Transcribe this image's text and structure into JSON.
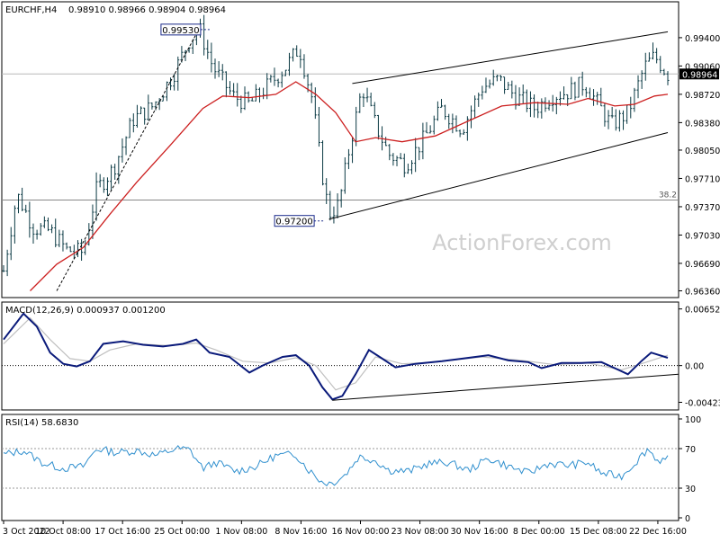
{
  "header": {
    "symbol": "EURCHF,H4",
    "ohlc": "0.98910 0.98966 0.98904 0.98964"
  },
  "watermark": "ActionForex.com",
  "colors": {
    "bars": "#0b3a44",
    "ma": "#cc1f1f",
    "macd_line": "#0a1a7a",
    "signal": "#bfbfbf",
    "rsi": "#2f8fce",
    "channel": "#000000",
    "price_tag_bg": "#000000",
    "price_tag_fg": "#ffffff",
    "grid_level": "#888888",
    "watermark": "#cfcfcf"
  },
  "chart_data": [
    {
      "type": "candlestick",
      "title": "EURCHF,H4",
      "xlabel": "",
      "ylabel": "",
      "x_ticks": [
        "3 Oct 2022",
        "10 Oct 08:00",
        "17 Oct 16:00",
        "25 Oct 00:00",
        "1 Nov 08:00",
        "8 Nov 16:00",
        "16 Nov 00:00",
        "23 Nov 08:00",
        "30 Nov 16:00",
        "8 Dec 00:00",
        "15 Dec 08:00",
        "22 Dec 16:00"
      ],
      "y_ticks": [
        0.994,
        0.9906,
        0.9872,
        0.9838,
        0.9805,
        0.9771,
        0.9737,
        0.9703,
        0.9669,
        0.9636
      ],
      "y_tick_labels": [
        "0.99400",
        "0.99060",
        "0.98720",
        "0.98380",
        "0.98050",
        "0.97710",
        "0.97370",
        "0.97030",
        "0.96690",
        "0.96360"
      ],
      "ylim": [
        0.9629,
        0.9982
      ],
      "last_price": 0.98964,
      "last_price_label": "0.98964",
      "fib_level": 0.9745,
      "fib_label": "38.2",
      "annotations": [
        {
          "label": "0.99530",
          "value": 0.9953,
          "at": "25 Oct"
        },
        {
          "label": "0.97200",
          "value": 0.972,
          "at": "14 Nov"
        }
      ],
      "price_path": [
        {
          "t": 0.0,
          "v": 0.966
        },
        {
          "t": 0.02,
          "v": 0.9752
        },
        {
          "t": 0.045,
          "v": 0.9712
        },
        {
          "t": 0.07,
          "v": 0.9708
        },
        {
          "t": 0.095,
          "v": 0.9685
        },
        {
          "t": 0.12,
          "v": 0.9682
        },
        {
          "t": 0.14,
          "v": 0.9758
        },
        {
          "t": 0.165,
          "v": 0.9782
        },
        {
          "t": 0.195,
          "v": 0.9842
        },
        {
          "t": 0.225,
          "v": 0.9858
        },
        {
          "t": 0.255,
          "v": 0.9895
        },
        {
          "t": 0.28,
          "v": 0.9938
        },
        {
          "t": 0.295,
          "v": 0.995
        },
        {
          "t": 0.315,
          "v": 0.9905
        },
        {
          "t": 0.345,
          "v": 0.987
        },
        {
          "t": 0.37,
          "v": 0.986
        },
        {
          "t": 0.395,
          "v": 0.988
        },
        {
          "t": 0.425,
          "v": 0.9905
        },
        {
          "t": 0.445,
          "v": 0.9928
        },
        {
          "t": 0.465,
          "v": 0.9865
        },
        {
          "t": 0.478,
          "v": 0.9785
        },
        {
          "t": 0.49,
          "v": 0.9728
        },
        {
          "t": 0.505,
          "v": 0.974
        },
        {
          "t": 0.52,
          "v": 0.9805
        },
        {
          "t": 0.54,
          "v": 0.988
        },
        {
          "t": 0.56,
          "v": 0.9835
        },
        {
          "t": 0.58,
          "v": 0.98
        },
        {
          "t": 0.605,
          "v": 0.9788
        },
        {
          "t": 0.63,
          "v": 0.9815
        },
        {
          "t": 0.66,
          "v": 0.9855
        },
        {
          "t": 0.69,
          "v": 0.983
        },
        {
          "t": 0.72,
          "v": 0.988
        },
        {
          "t": 0.745,
          "v": 0.989
        },
        {
          "t": 0.77,
          "v": 0.987
        },
        {
          "t": 0.8,
          "v": 0.9855
        },
        {
          "t": 0.825,
          "v": 0.987
        },
        {
          "t": 0.85,
          "v": 0.9875
        },
        {
          "t": 0.875,
          "v": 0.9885
        },
        {
          "t": 0.895,
          "v": 0.986
        },
        {
          "t": 0.915,
          "v": 0.9835
        },
        {
          "t": 0.94,
          "v": 0.985
        },
        {
          "t": 0.965,
          "v": 0.9905
        },
        {
          "t": 0.98,
          "v": 0.9918
        },
        {
          "t": 1.0,
          "v": 0.9896
        }
      ],
      "ma_path": [
        {
          "t": 0.04,
          "v": 0.9636
        },
        {
          "t": 0.08,
          "v": 0.9668
        },
        {
          "t": 0.12,
          "v": 0.9688
        },
        {
          "t": 0.16,
          "v": 0.9728
        },
        {
          "t": 0.2,
          "v": 0.9766
        },
        {
          "t": 0.25,
          "v": 0.981
        },
        {
          "t": 0.3,
          "v": 0.9855
        },
        {
          "t": 0.33,
          "v": 0.987
        },
        {
          "t": 0.37,
          "v": 0.9868
        },
        {
          "t": 0.41,
          "v": 0.9872
        },
        {
          "t": 0.44,
          "v": 0.9887
        },
        {
          "t": 0.47,
          "v": 0.9872
        },
        {
          "t": 0.5,
          "v": 0.985
        },
        {
          "t": 0.53,
          "v": 0.9815
        },
        {
          "t": 0.56,
          "v": 0.982
        },
        {
          "t": 0.6,
          "v": 0.9815
        },
        {
          "t": 0.65,
          "v": 0.9822
        },
        {
          "t": 0.7,
          "v": 0.984
        },
        {
          "t": 0.75,
          "v": 0.9858
        },
        {
          "t": 0.8,
          "v": 0.9862
        },
        {
          "t": 0.85,
          "v": 0.986
        },
        {
          "t": 0.88,
          "v": 0.9867
        },
        {
          "t": 0.92,
          "v": 0.9858
        },
        {
          "t": 0.95,
          "v": 0.986
        },
        {
          "t": 0.98,
          "v": 0.987
        },
        {
          "t": 1.0,
          "v": 0.9872
        }
      ],
      "channel_lines": [
        {
          "from": {
            "t": 0.525,
            "v": 0.9885
          },
          "to": {
            "t": 1.0,
            "v": 0.9947
          }
        },
        {
          "from": {
            "t": 0.49,
            "v": 0.9722
          },
          "to": {
            "t": 1.0,
            "v": 0.9826
          }
        }
      ],
      "dashed_line": {
        "from": {
          "t": 0.08,
          "v": 0.9636
        },
        "to": {
          "t": 0.296,
          "v": 0.9953
        }
      }
    },
    {
      "type": "line",
      "title": "MACD(12,26,9) 0.000937 0.001200",
      "xlabel": "",
      "ylabel": "",
      "y_ticks": [
        0.006529,
        0.0,
        -0.004233
      ],
      "y_tick_labels": [
        "0.006529",
        "0.00",
        "-0.004233"
      ],
      "ylim": [
        -0.0047,
        0.0067
      ],
      "series": [
        {
          "name": "MACD",
          "points": [
            {
              "t": 0.0,
              "v": 0.003
            },
            {
              "t": 0.03,
              "v": 0.006
            },
            {
              "t": 0.05,
              "v": 0.0045
            },
            {
              "t": 0.07,
              "v": 0.0015
            },
            {
              "t": 0.09,
              "v": 0.0002
            },
            {
              "t": 0.11,
              "v": -0.0001
            },
            {
              "t": 0.13,
              "v": 0.0005
            },
            {
              "t": 0.15,
              "v": 0.0025
            },
            {
              "t": 0.18,
              "v": 0.0028
            },
            {
              "t": 0.21,
              "v": 0.0024
            },
            {
              "t": 0.24,
              "v": 0.0022
            },
            {
              "t": 0.27,
              "v": 0.0025
            },
            {
              "t": 0.29,
              "v": 0.003
            },
            {
              "t": 0.31,
              "v": 0.0015
            },
            {
              "t": 0.34,
              "v": 0.001
            },
            {
              "t": 0.37,
              "v": -0.0008
            },
            {
              "t": 0.39,
              "v": 0.0
            },
            {
              "t": 0.42,
              "v": 0.001
            },
            {
              "t": 0.44,
              "v": 0.0012
            },
            {
              "t": 0.46,
              "v": 0.0
            },
            {
              "t": 0.48,
              "v": -0.0025
            },
            {
              "t": 0.495,
              "v": -0.0039
            },
            {
              "t": 0.51,
              "v": -0.0035
            },
            {
              "t": 0.53,
              "v": -0.001
            },
            {
              "t": 0.55,
              "v": 0.0018
            },
            {
              "t": 0.57,
              "v": 0.0008
            },
            {
              "t": 0.59,
              "v": -0.0002
            },
            {
              "t": 0.62,
              "v": 0.0002
            },
            {
              "t": 0.66,
              "v": 0.0005
            },
            {
              "t": 0.7,
              "v": 0.0009
            },
            {
              "t": 0.73,
              "v": 0.0012
            },
            {
              "t": 0.76,
              "v": 0.0006
            },
            {
              "t": 0.79,
              "v": 0.0004
            },
            {
              "t": 0.81,
              "v": -0.0003
            },
            {
              "t": 0.84,
              "v": 0.0003
            },
            {
              "t": 0.87,
              "v": 0.0003
            },
            {
              "t": 0.9,
              "v": 0.0004
            },
            {
              "t": 0.92,
              "v": -0.0003
            },
            {
              "t": 0.94,
              "v": -0.001
            },
            {
              "t": 0.96,
              "v": 0.0005
            },
            {
              "t": 0.975,
              "v": 0.0015
            },
            {
              "t": 1.0,
              "v": 0.0009
            }
          ]
        },
        {
          "name": "Signal",
          "points": [
            {
              "t": 0.0,
              "v": 0.0025
            },
            {
              "t": 0.04,
              "v": 0.0055
            },
            {
              "t": 0.07,
              "v": 0.003
            },
            {
              "t": 0.1,
              "v": 0.0008
            },
            {
              "t": 0.13,
              "v": 0.0005
            },
            {
              "t": 0.16,
              "v": 0.0018
            },
            {
              "t": 0.2,
              "v": 0.0025
            },
            {
              "t": 0.25,
              "v": 0.0023
            },
            {
              "t": 0.29,
              "v": 0.0026
            },
            {
              "t": 0.32,
              "v": 0.0018
            },
            {
              "t": 0.36,
              "v": 0.0005
            },
            {
              "t": 0.4,
              "v": 0.0003
            },
            {
              "t": 0.44,
              "v": 0.0009
            },
            {
              "t": 0.47,
              "v": 0.0
            },
            {
              "t": 0.5,
              "v": -0.0028
            },
            {
              "t": 0.53,
              "v": -0.002
            },
            {
              "t": 0.56,
              "v": 0.001
            },
            {
              "t": 0.6,
              "v": 0.0002
            },
            {
              "t": 0.65,
              "v": 0.0004
            },
            {
              "t": 0.72,
              "v": 0.001
            },
            {
              "t": 0.78,
              "v": 0.0006
            },
            {
              "t": 0.83,
              "v": 0.0001
            },
            {
              "t": 0.88,
              "v": 0.0003
            },
            {
              "t": 0.93,
              "v": -0.0005
            },
            {
              "t": 0.96,
              "v": 0.0002
            },
            {
              "t": 1.0,
              "v": 0.0012
            }
          ]
        }
      ],
      "trend_line": {
        "from": {
          "t": 0.495,
          "v": -0.004
        },
        "to": {
          "t": 1.0,
          "v": -0.001
        }
      }
    },
    {
      "type": "line",
      "title": "RSI(14) 58.6830",
      "xlabel": "",
      "ylabel": "",
      "y_ticks": [
        100,
        70,
        30,
        0
      ],
      "y_tick_labels": [
        "100",
        "70",
        "30",
        "0"
      ],
      "levels": [
        70,
        30
      ],
      "ylim": [
        0,
        100
      ],
      "series": [
        {
          "name": "RSI(14)",
          "points": [
            {
              "t": 0.0,
              "v": 64
            },
            {
              "t": 0.03,
              "v": 68
            },
            {
              "t": 0.06,
              "v": 55
            },
            {
              "t": 0.09,
              "v": 50
            },
            {
              "t": 0.12,
              "v": 52
            },
            {
              "t": 0.14,
              "v": 70
            },
            {
              "t": 0.17,
              "v": 66
            },
            {
              "t": 0.2,
              "v": 68
            },
            {
              "t": 0.23,
              "v": 63
            },
            {
              "t": 0.26,
              "v": 70
            },
            {
              "t": 0.28,
              "v": 69
            },
            {
              "t": 0.3,
              "v": 50
            },
            {
              "t": 0.32,
              "v": 56
            },
            {
              "t": 0.35,
              "v": 47
            },
            {
              "t": 0.38,
              "v": 52
            },
            {
              "t": 0.41,
              "v": 63
            },
            {
              "t": 0.44,
              "v": 64
            },
            {
              "t": 0.46,
              "v": 48
            },
            {
              "t": 0.48,
              "v": 36
            },
            {
              "t": 0.495,
              "v": 35
            },
            {
              "t": 0.515,
              "v": 44
            },
            {
              "t": 0.535,
              "v": 62
            },
            {
              "t": 0.56,
              "v": 58
            },
            {
              "t": 0.58,
              "v": 48
            },
            {
              "t": 0.61,
              "v": 47
            },
            {
              "t": 0.64,
              "v": 55
            },
            {
              "t": 0.67,
              "v": 56
            },
            {
              "t": 0.7,
              "v": 48
            },
            {
              "t": 0.73,
              "v": 60
            },
            {
              "t": 0.76,
              "v": 52
            },
            {
              "t": 0.79,
              "v": 45
            },
            {
              "t": 0.82,
              "v": 55
            },
            {
              "t": 0.85,
              "v": 53
            },
            {
              "t": 0.88,
              "v": 56
            },
            {
              "t": 0.9,
              "v": 45
            },
            {
              "t": 0.93,
              "v": 42
            },
            {
              "t": 0.95,
              "v": 55
            },
            {
              "t": 0.97,
              "v": 70
            },
            {
              "t": 0.985,
              "v": 58
            },
            {
              "t": 1.0,
              "v": 59
            }
          ]
        }
      ]
    }
  ]
}
